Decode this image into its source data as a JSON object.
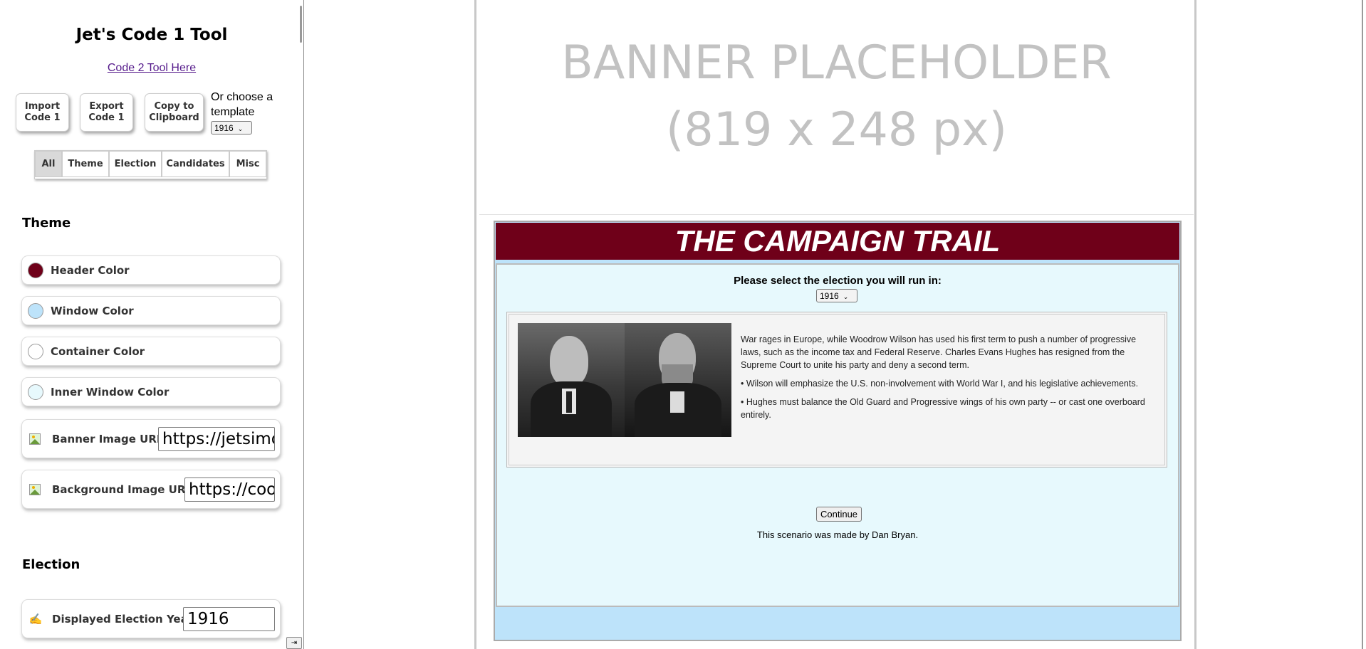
{
  "sidebar": {
    "title": "Jet's Code 1 Tool",
    "code2_link": "Code 2 Tool Here",
    "buttons": {
      "import": "Import\nCode 1",
      "export": "Export\nCode 1",
      "copy": "Copy to\nClipboard"
    },
    "template_label": "Or choose a template",
    "template_value": "1916",
    "filters": [
      "All",
      "Theme",
      "Election",
      "Candidates",
      "Misc"
    ],
    "theme": {
      "heading": "Theme",
      "header_color": {
        "label": "Header Color",
        "value": "#6f0019"
      },
      "window_color": {
        "label": "Window Color",
        "value": "#bde3fa"
      },
      "container_color": {
        "label": "Container Color",
        "value": "#ffffff"
      },
      "inner_window_color": {
        "label": "Inner Window Color",
        "value": "#e7f9fd"
      },
      "banner_url": {
        "label": "Banner Image URL",
        "value": "https://jetsimo"
      },
      "background_url": {
        "label": "Background Image URL",
        "value": "https://coo"
      }
    },
    "election": {
      "heading": "Election",
      "year": {
        "label": "Displayed Election Year",
        "value": "1916"
      }
    },
    "collapse_glyph": "⇥"
  },
  "preview": {
    "banner_line1": "BANNER PLACEHOLDER",
    "banner_line2": "(819 x 248 px)",
    "header_title": "THE CAMPAIGN TRAIL",
    "select_prompt": "Please select the election you will run in:",
    "election_value": "1916",
    "description": {
      "intro": "War rages in Europe, while Woodrow Wilson has used his first term to push a number of progressive laws, such as the income tax and Federal Reserve. Charles Evans Hughes has resigned from the Supreme Court to unite his party and deny a second term.",
      "bullet1": "• Wilson will emphasize the U.S. non-involvement with World War I, and his legislative achievements.",
      "bullet2": "• Hughes must balance the Old Guard and Progressive wings of his own party -- or cast one overboard entirely."
    },
    "continue_label": "Continue",
    "credit": "This scenario was made by Dan Bryan."
  }
}
